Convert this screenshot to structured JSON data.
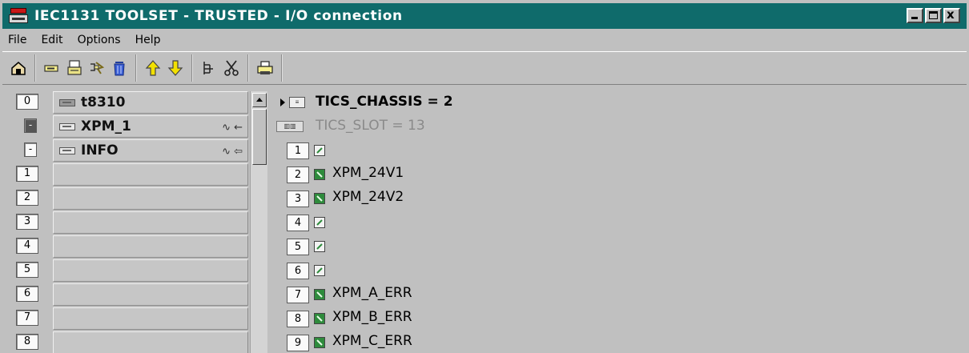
{
  "window": {
    "title": "IEC1131 TOOLSET - TRUSTED - I/O connection",
    "controls": {
      "minimize": "_",
      "maximize": "□",
      "close": "x"
    }
  },
  "menu": [
    {
      "label": "File"
    },
    {
      "label": "Edit"
    },
    {
      "label": "Options"
    },
    {
      "label": "Help"
    }
  ],
  "toolbar": {
    "groups": [
      [
        "home-icon"
      ],
      [
        "new-slot-icon",
        "print-list-icon",
        "connect-icon",
        "trash-icon"
      ],
      [
        "arrow-up-icon",
        "arrow-down-icon"
      ],
      [
        "tree-icon",
        "cut-icon"
      ],
      [
        "printer-icon"
      ]
    ]
  },
  "left_panel": {
    "rows": [
      {
        "index": "0",
        "label": "t8310",
        "link": "",
        "kind": "root"
      },
      {
        "index": "-",
        "label": "XPM_1",
        "link": "∿ ←",
        "kind": "sub-active"
      },
      {
        "index": "-",
        "label": "INFO",
        "link": "∿ ⇦",
        "kind": "sub"
      },
      {
        "index": "1",
        "label": "",
        "link": "",
        "kind": "empty"
      },
      {
        "index": "2",
        "label": "",
        "link": "",
        "kind": "empty"
      },
      {
        "index": "3",
        "label": "",
        "link": "",
        "kind": "empty"
      },
      {
        "index": "4",
        "label": "",
        "link": "",
        "kind": "empty"
      },
      {
        "index": "5",
        "label": "",
        "link": "",
        "kind": "empty"
      },
      {
        "index": "6",
        "label": "",
        "link": "",
        "kind": "empty"
      },
      {
        "index": "7",
        "label": "",
        "link": "",
        "kind": "empty"
      },
      {
        "index": "8",
        "label": "",
        "link": "",
        "kind": "empty"
      }
    ]
  },
  "right_panel": {
    "chassis": "TICS_CHASSIS = 2",
    "slot": "TICS_SLOT = 13",
    "channels": [
      {
        "index": "1",
        "name": "",
        "connected": false
      },
      {
        "index": "2",
        "name": "XPM_24V1",
        "connected": true
      },
      {
        "index": "3",
        "name": "XPM_24V2",
        "connected": true
      },
      {
        "index": "4",
        "name": "",
        "connected": false
      },
      {
        "index": "5",
        "name": "",
        "connected": false
      },
      {
        "index": "6",
        "name": "",
        "connected": false
      },
      {
        "index": "7",
        "name": "XPM_A_ERR",
        "connected": true
      },
      {
        "index": "8",
        "name": "XPM_B_ERR",
        "connected": true
      },
      {
        "index": "9",
        "name": "XPM_C_ERR",
        "connected": true
      }
    ]
  },
  "colors": {
    "titlebar": "#0f6b6b",
    "face": "#c0c0c0",
    "connected": "#2e8b3c"
  }
}
